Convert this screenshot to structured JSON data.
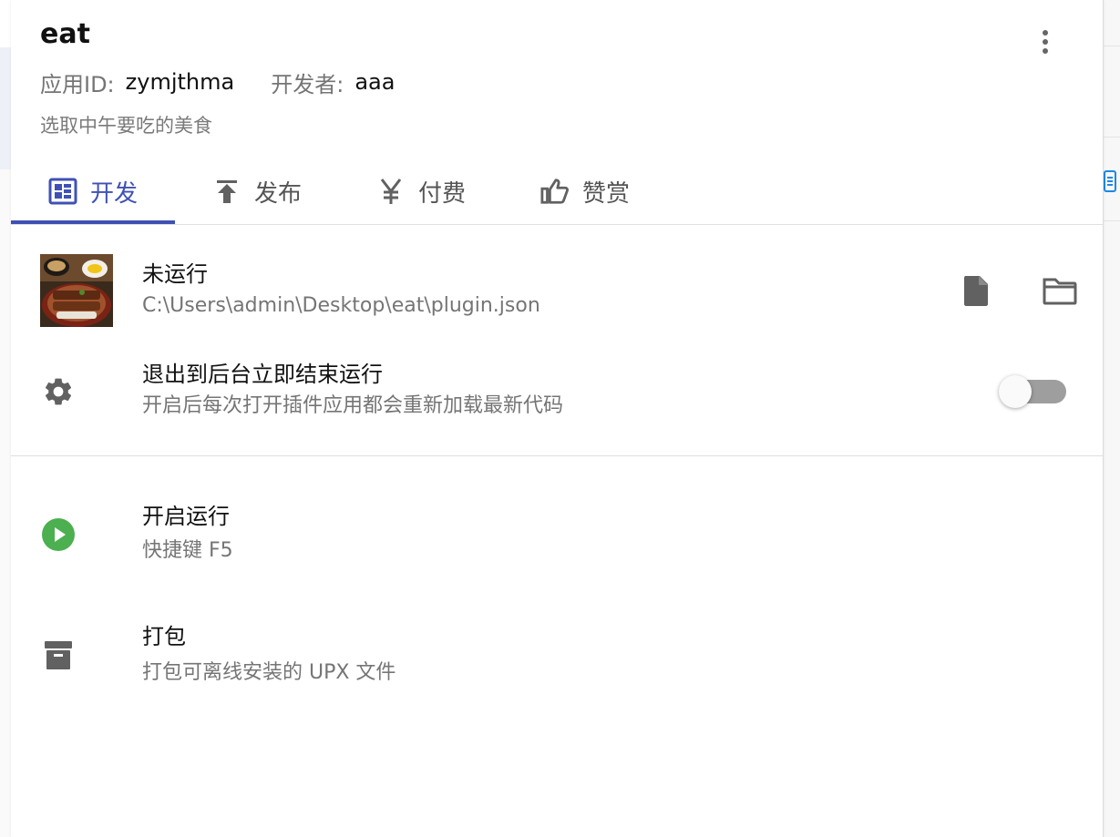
{
  "app": {
    "title": "eat",
    "id_label": "应用ID:",
    "id_value": "zymjthma",
    "developer_label": "开发者:",
    "developer_value": "aaa",
    "description": "选取中午要吃的美食"
  },
  "tabs": [
    {
      "label": "开发",
      "icon": "dashboard-icon",
      "active": true
    },
    {
      "label": "发布",
      "icon": "upload-icon",
      "active": false
    },
    {
      "label": "付费",
      "icon": "yen-icon",
      "active": false
    },
    {
      "label": "赞赏",
      "icon": "thumb-up-icon",
      "active": false
    }
  ],
  "plugin": {
    "status": "未运行",
    "path": "C:\\Users\\admin\\Desktop\\eat\\plugin.json"
  },
  "settings": {
    "exit_title": "退出到后台立即结束运行",
    "exit_desc": "开启后每次打开插件应用都会重新加载最新代码",
    "exit_enabled": false
  },
  "actions": {
    "run_title": "开启运行",
    "run_desc": "快捷键 F5",
    "pack_title": "打包",
    "pack_desc": "打包可离线安装的 UPX 文件"
  },
  "colors": {
    "accent": "#3f51b5",
    "run_green": "#4caf50",
    "icon_gray": "#616161",
    "toggle_off": "#9e9e9e"
  }
}
